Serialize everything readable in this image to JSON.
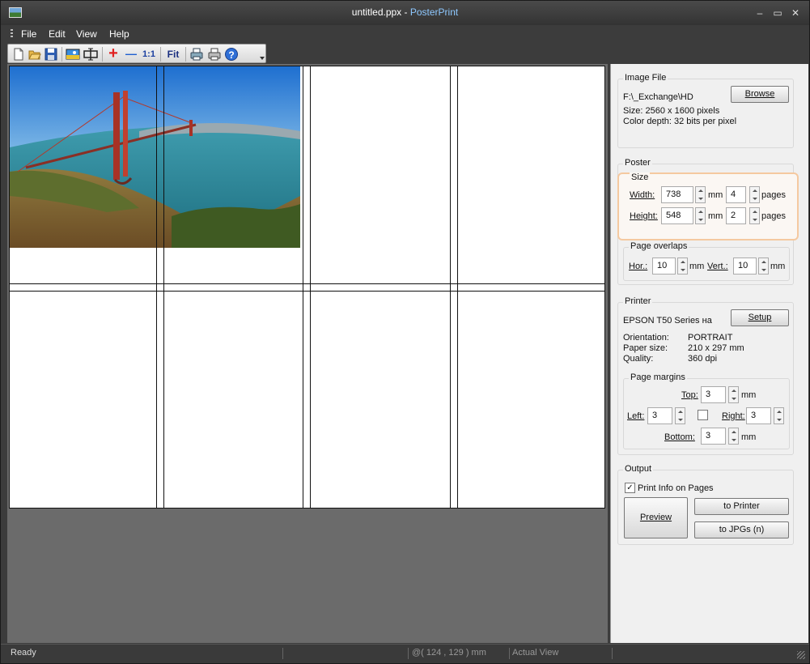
{
  "window": {
    "title_file": "untitled.ppx - ",
    "title_app": "PosterPrint",
    "controls": {
      "minimize": "–",
      "maximize": "▭",
      "close": "✕"
    }
  },
  "menu": {
    "file": "File",
    "edit": "Edit",
    "view": "View",
    "help": "Help"
  },
  "toolbar": {
    "items": [
      "new-icon",
      "open-icon",
      "save-icon",
      "image-icon",
      "resize-icon",
      "zoom-in-icon",
      "zoom-out-icon",
      "zoom-actual-icon",
      "fit-icon",
      "print-setup-icon",
      "print-icon",
      "help-icon"
    ],
    "zoom_actual_label": "1:1",
    "fit_label": "Fit",
    "plus_glyph": "+",
    "minus_glyph": "—",
    "help_glyph": "?"
  },
  "image_file": {
    "title": "Image File",
    "path": "F:\\_Exchange\\HD",
    "browse": "Browse",
    "size": "Size: 2560 x 1600 pixels",
    "color_depth": "Color depth: 32 bits per pixel"
  },
  "poster": {
    "title": "Poster",
    "size_title": "Size",
    "width_label": "Width:",
    "width_value": "738",
    "width_unit": "mm",
    "width_pages": "4",
    "height_label": "Height:",
    "height_value": "548",
    "height_unit": "mm",
    "height_pages": "2",
    "pages_label": "pages",
    "overlaps_title": "Page overlaps",
    "hor_label": "Hor.:",
    "hor_value": "10",
    "vert_label": "Vert.:",
    "vert_value": "10",
    "overlap_unit": "mm"
  },
  "printer": {
    "title": "Printer",
    "name": "EPSON T50 Series на",
    "setup": "Setup",
    "orientation_label": "Orientation:",
    "orientation_value": "PORTRAIT",
    "paper_label": "Paper size:",
    "paper_value": "210 x 297 mm",
    "quality_label": "Quality:",
    "quality_value": "360 dpi",
    "margins_title": "Page margins",
    "top_label": "Top:",
    "top_value": "3",
    "left_label": "Left:",
    "left_value": "3",
    "right_label": "Right:",
    "right_value": "3",
    "bottom_label": "Bottom:",
    "bottom_value": "3",
    "unit": "mm"
  },
  "output": {
    "title": "Output",
    "print_info_label": "Print Info on Pages",
    "print_info_checked": "✓",
    "preview": "Preview",
    "to_printer": "to Printer",
    "to_jpgs": "to JPGs (n)"
  },
  "status": {
    "ready": "Ready",
    "coords": "@( 124 , 129 ) mm",
    "view": "Actual View"
  }
}
